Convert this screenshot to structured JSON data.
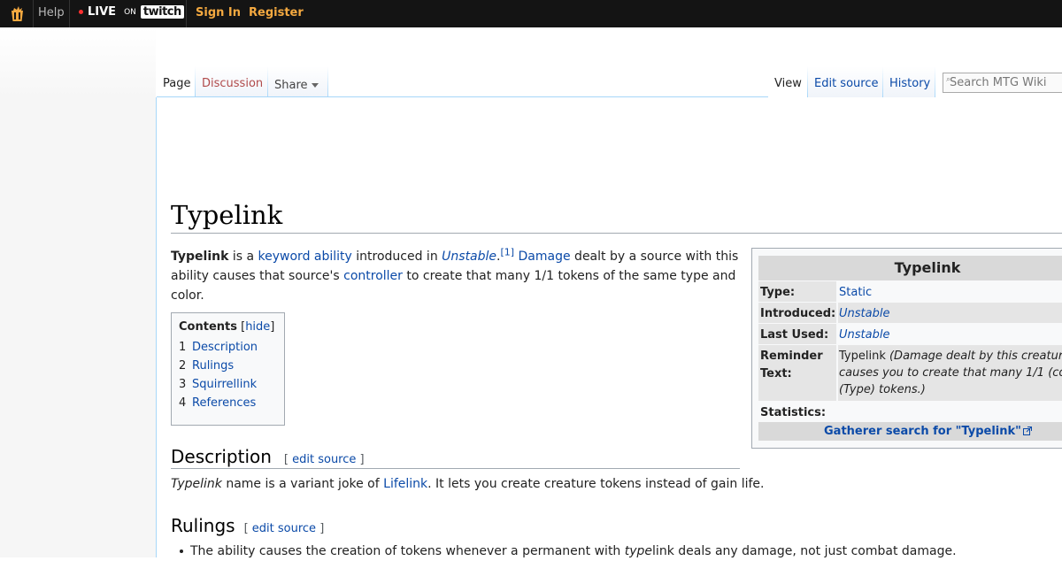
{
  "topbar": {
    "help": "Help",
    "live": "LIVE",
    "on": "ON",
    "twitch": "twitch",
    "sign_in": "Sign In",
    "register": "Register",
    "accent": "#f4a940"
  },
  "tabs": {
    "page": "Page",
    "discussion": "Discussion",
    "share": "Share",
    "view": "View",
    "edit_source": "Edit source",
    "history": "History"
  },
  "search": {
    "placeholder": "Search MTG Wiki"
  },
  "article": {
    "title": "Typelink",
    "intro": {
      "bold": "Typelink",
      "t1": " is a ",
      "l_keyword": "keyword ability",
      "t2": " introduced in ",
      "l_unstable": "Unstable",
      "t3": ".",
      "ref": "[1]",
      "t4": " ",
      "l_damage": "Damage",
      "t5": " dealt by a source with this ability causes that source's ",
      "l_controller": "controller",
      "t6": " to create that many 1/1 tokens of the same type and color."
    },
    "toc": {
      "title": "Contents",
      "hide_open": "[",
      "hide": "hide",
      "hide_close": "]",
      "items": [
        {
          "num": "1",
          "label": "Description"
        },
        {
          "num": "2",
          "label": "Rulings"
        },
        {
          "num": "3",
          "label": "Squirrellink"
        },
        {
          "num": "4",
          "label": "References"
        }
      ]
    },
    "description": {
      "heading": "Description",
      "edit_open": "[ ",
      "edit": "edit source",
      "edit_close": " ]",
      "italic": "Typelink",
      "t1": " name is a variant joke of ",
      "l_lifelink": "Lifelink",
      "t2": ". It lets you create creature tokens instead of gain life."
    },
    "rulings": {
      "heading": "Rulings",
      "edit_open": "[ ",
      "edit": "edit source",
      "edit_close": " ]",
      "item1_a": "The ability causes the creation of tokens whenever a permanent with ",
      "item1_i": "type",
      "item1_b": "link deals any damage, not just combat damage."
    }
  },
  "infobox": {
    "title": "Typelink",
    "rows": [
      {
        "label": "Type:",
        "value": "Static"
      },
      {
        "label": "Introduced:",
        "value": "Unstable"
      },
      {
        "label": "Last Used:",
        "value": "Unstable"
      },
      {
        "label": "Reminder Text:",
        "value_plain": "Typelink ",
        "value_italic_1": "(Damage dealt by this creatur",
        "value_italic_2": "causes you to create that many 1/1 (co",
        "value_italic_3": "(Type) tokens.)"
      },
      {
        "label": "Statistics:",
        "value": ""
      }
    ],
    "gatherer": "Gatherer search for \"Typelink\""
  }
}
